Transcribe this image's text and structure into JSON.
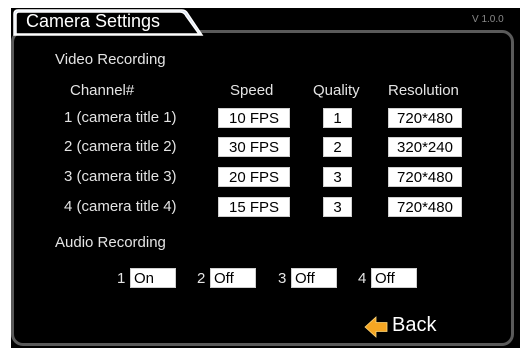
{
  "window": {
    "title": "Camera Settings",
    "version": "V 1.0.0"
  },
  "video": {
    "section_label": "Video Recording",
    "columns": {
      "channel": "Channel#",
      "speed": "Speed",
      "quality": "Quality",
      "resolution": "Resolution"
    },
    "rows": [
      {
        "channel": "1 (camera title 1)",
        "speed": "10 FPS",
        "quality": "1",
        "resolution": "720*480"
      },
      {
        "channel": "2 (camera title 2)",
        "speed": "30 FPS",
        "quality": "2",
        "resolution": "320*240"
      },
      {
        "channel": "3 (camera title 3)",
        "speed": "20 FPS",
        "quality": "3",
        "resolution": "720*480"
      },
      {
        "channel": "4 (camera title 4)",
        "speed": "15 FPS",
        "quality": "3",
        "resolution": "720*480"
      }
    ]
  },
  "audio": {
    "section_label": "Audio Recording",
    "channels": [
      {
        "number": "1",
        "value": "On"
      },
      {
        "number": "2",
        "value": "Off"
      },
      {
        "number": "3",
        "value": "Off"
      },
      {
        "number": "4",
        "value": "Off"
      }
    ]
  },
  "footer": {
    "back_label": "Back",
    "back_icon": "arrow-left-icon",
    "back_icon_color": "#f5a623"
  },
  "colors": {
    "background": "#000000",
    "panel_border": "#5a5a5a",
    "tab_fill": "#d8e4f4",
    "field_background": "#ffffff"
  }
}
